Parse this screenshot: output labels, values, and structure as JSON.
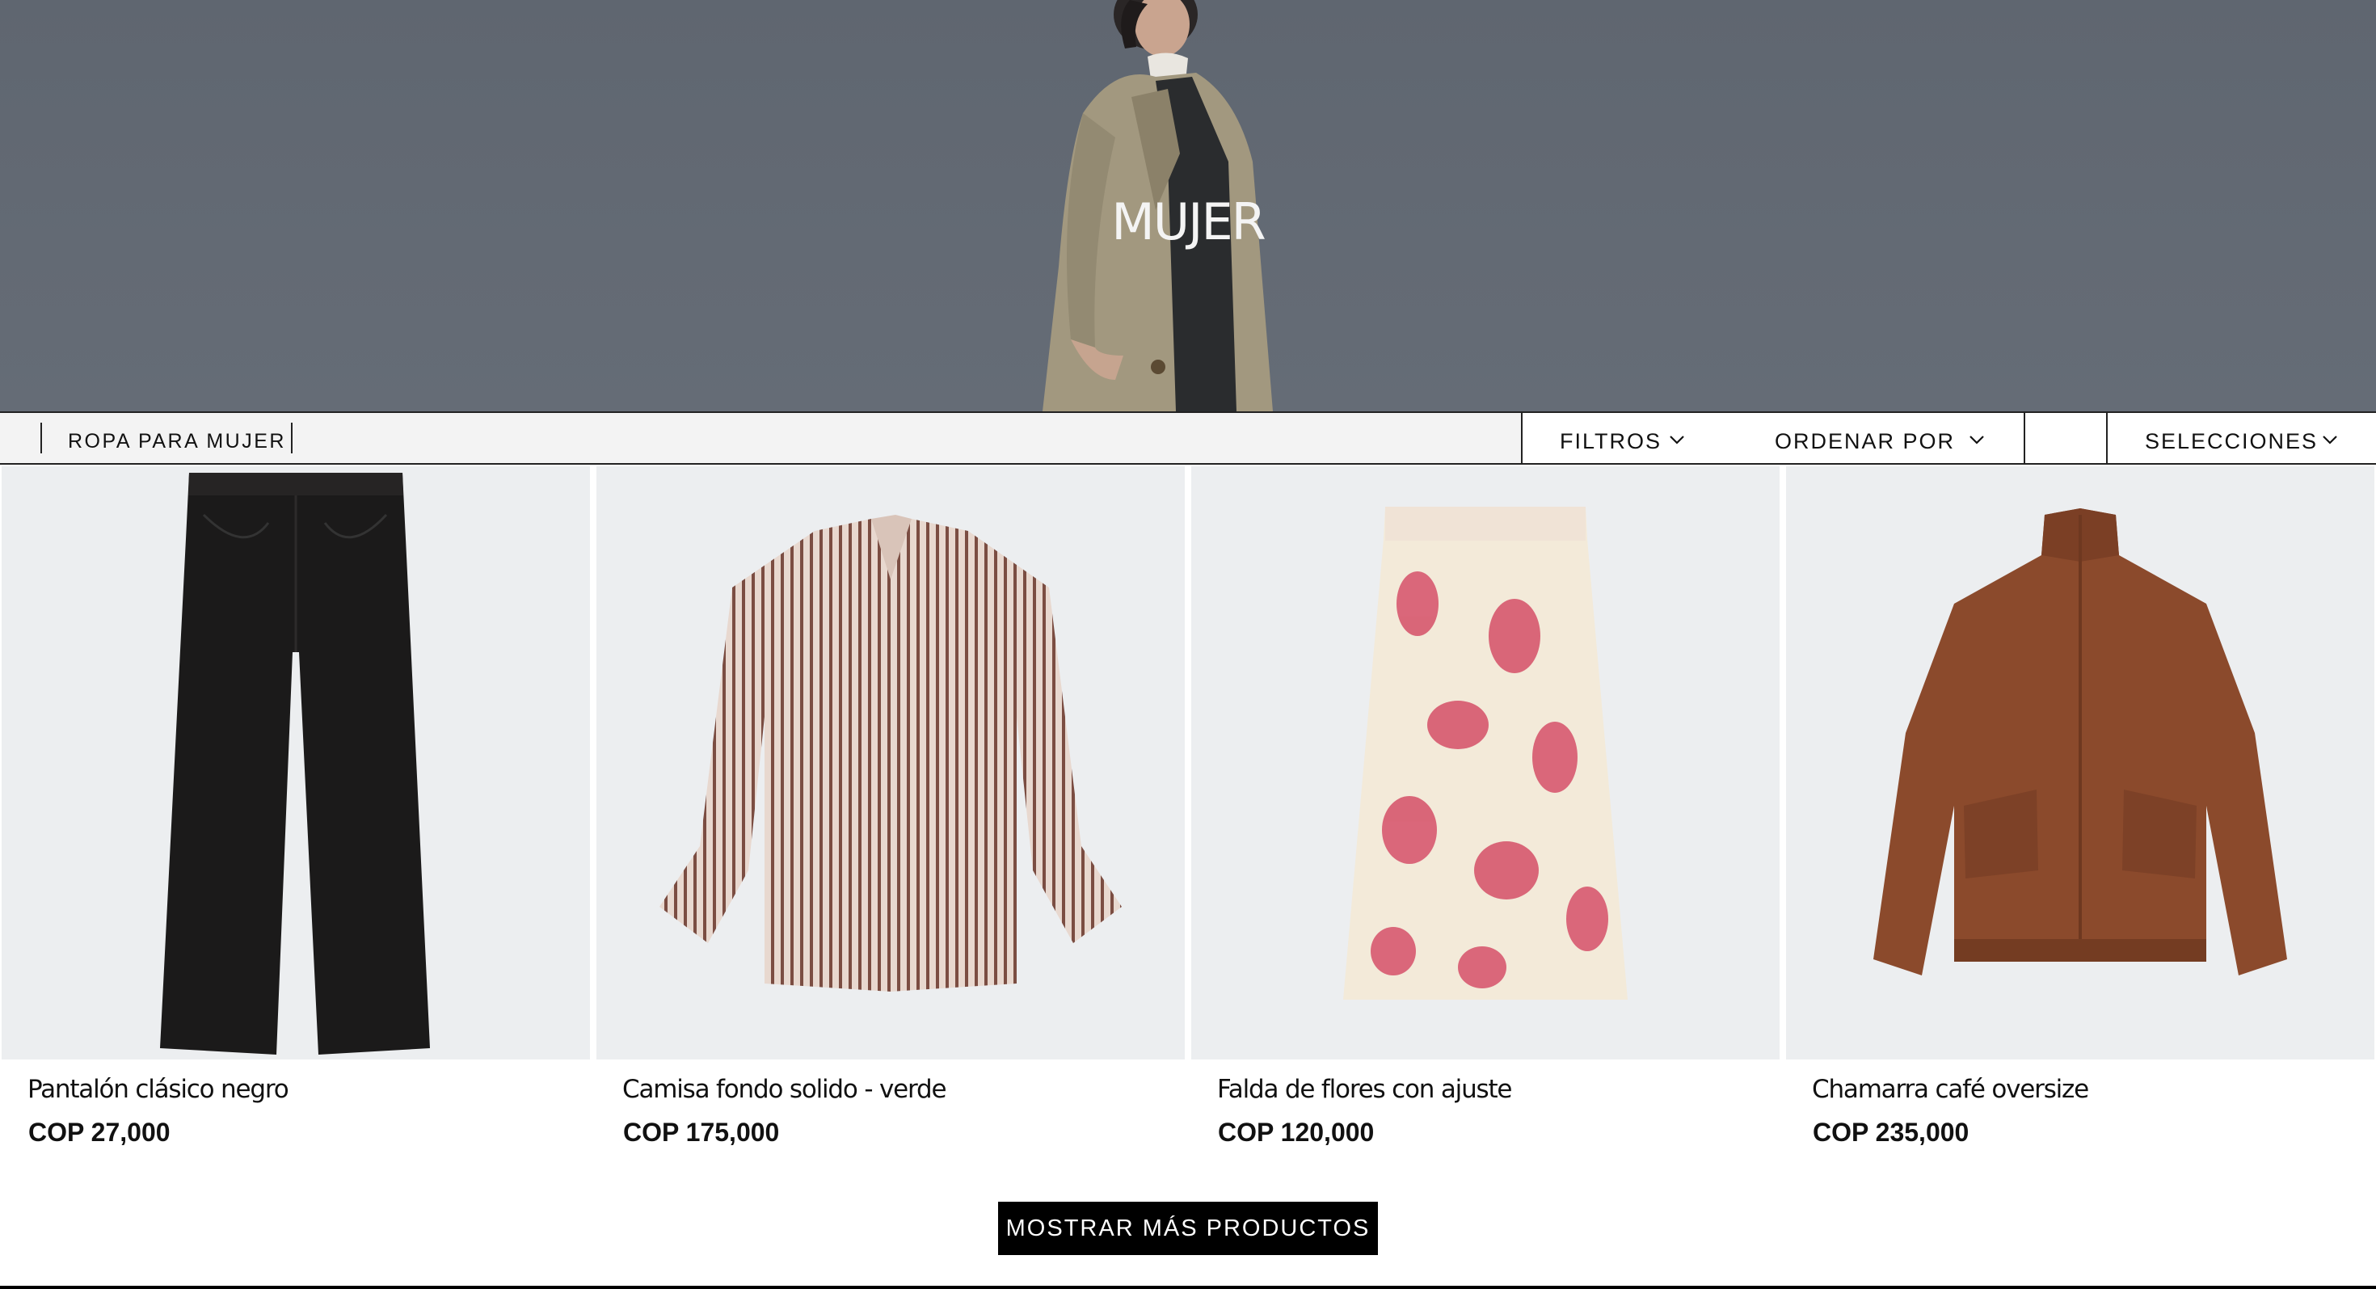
{
  "hero": {
    "title": "MUJER"
  },
  "toolbar": {
    "breadcrumb": "ROPA PARA MUJER",
    "filters_label": "FILTROS",
    "sort_label": "ORDENAR POR",
    "selections_label": "SELECCIONES"
  },
  "products": [
    {
      "name": "Pantalón clásico negro",
      "price": "COP 27,000"
    },
    {
      "name": "Camisa fondo solido - verde",
      "price": "COP 175,000"
    },
    {
      "name": "Falda de flores con ajuste",
      "price": "COP 120,000"
    },
    {
      "name": "Chamarra café oversize",
      "price": "COP 235,000"
    }
  ],
  "load_more": {
    "label": "MOSTRAR MÁS PRODUCTOS"
  },
  "colors": {
    "hero_bg": "#636a74",
    "accent": "#000000",
    "card_bg": "#ecedef"
  },
  "icons": {
    "dropdown": "chevron-down-icon"
  }
}
